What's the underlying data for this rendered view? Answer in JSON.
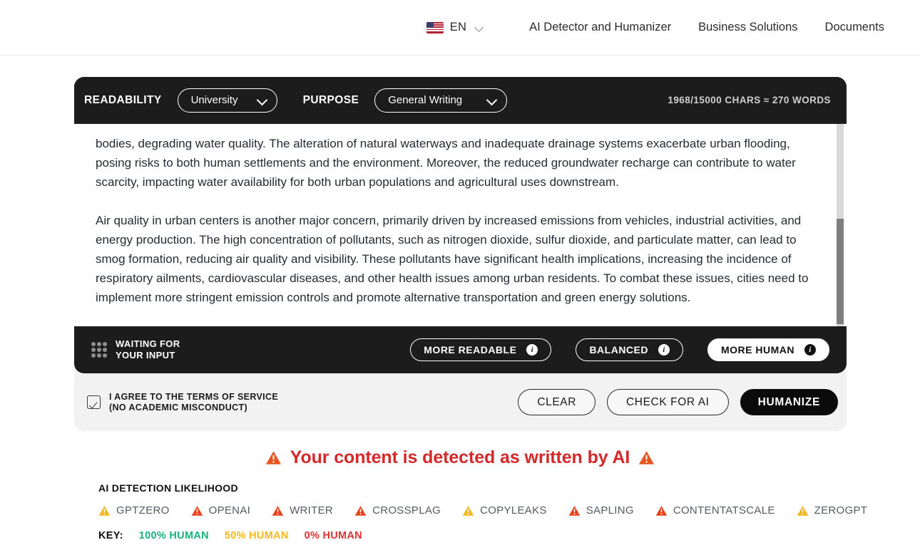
{
  "nav": {
    "language": "EN",
    "flag_icon": "us-flag-icon",
    "chevron_icon": "chevron-down-icon",
    "links": [
      {
        "label": "AI Detector and Humanizer"
      },
      {
        "label": "Business Solutions"
      },
      {
        "label": "Documents"
      }
    ]
  },
  "toolbar": {
    "readability_label": "READABILITY",
    "readability_value": "University",
    "purpose_label": "PURPOSE",
    "purpose_value": "General Writing",
    "char_count": "1968/15000 CHARS ≈ 270 WORDS"
  },
  "editor": {
    "paragraphs": [
      "bodies, degrading water quality. The alteration of natural waterways and inadequate drainage systems exacerbate urban flooding, posing risks to both human settlements and the environment. Moreover, the reduced groundwater recharge can contribute to water scarcity, impacting water availability for both urban populations and agricultural uses downstream.",
      "Air quality in urban centers is another major concern, primarily driven by increased emissions from vehicles, industrial activities, and energy production. The high concentration of pollutants, such as nitrogen dioxide, sulfur dioxide, and particulate matter, can lead to smog formation, reducing air quality and visibility. These pollutants have significant health implications, increasing the incidence of respiratory ailments, cardiovascular diseases, and other health issues among urban residents. To combat these issues, cities need to implement more stringent emission controls and promote alternative transportation and green energy solutions."
    ]
  },
  "panel_bar": {
    "status_icon": "grid-dots-icon",
    "status_text": "WAITING FOR\nYOUR INPUT",
    "modes": [
      {
        "label": "MORE READABLE",
        "active": false,
        "info_icon": "info-icon"
      },
      {
        "label": "BALANCED",
        "active": false,
        "info_icon": "info-icon"
      },
      {
        "label": "MORE HUMAN",
        "active": true,
        "info_icon": "info-icon"
      }
    ]
  },
  "footer": {
    "agree_text": "I AGREE TO THE TERMS OF SERVICE\n(NO ACADEMIC MISCONDUCT)",
    "agree_checked": true,
    "checkbox_icon": "checked-checkbox-icon",
    "actions": [
      {
        "label": "CLEAR",
        "primary": false
      },
      {
        "label": "CHECK FOR AI",
        "primary": false
      },
      {
        "label": "HUMANIZE",
        "primary": true
      }
    ]
  },
  "detection": {
    "headline": "Your content is detected as written by AI",
    "headline_color": "#d62828",
    "warning_icon": "warning-triangle-icon",
    "warning_icon_color": "#e8541e",
    "likelihood_label": "AI DETECTION LIKELIHOOD",
    "detectors": [
      {
        "name": "GPTZERO",
        "level": "warn",
        "color": "#f5b91b",
        "icon": "warning-triangle-icon"
      },
      {
        "name": "OPENAI",
        "level": "danger",
        "color": "#e8441c",
        "icon": "warning-triangle-icon"
      },
      {
        "name": "WRITER",
        "level": "danger",
        "color": "#e8441c",
        "icon": "warning-triangle-icon"
      },
      {
        "name": "CROSSPLAG",
        "level": "danger",
        "color": "#e8441c",
        "icon": "warning-triangle-icon"
      },
      {
        "name": "COPYLEAKS",
        "level": "warn",
        "color": "#f5b91b",
        "icon": "warning-triangle-icon"
      },
      {
        "name": "SAPLING",
        "level": "danger",
        "color": "#e8441c",
        "icon": "warning-triangle-icon"
      },
      {
        "name": "CONTENTATSCALE",
        "level": "danger",
        "color": "#e8441c",
        "icon": "warning-triangle-icon"
      },
      {
        "name": "ZEROGPT",
        "level": "warn",
        "color": "#f5b91b",
        "icon": "warning-triangle-icon"
      }
    ],
    "key_label": "KEY:",
    "key_items": [
      {
        "label": "100% HUMAN",
        "color": "#17b27d"
      },
      {
        "label": "50% HUMAN",
        "color": "#f5b91b"
      },
      {
        "label": "0% HUMAN",
        "color": "#e03131"
      }
    ]
  }
}
